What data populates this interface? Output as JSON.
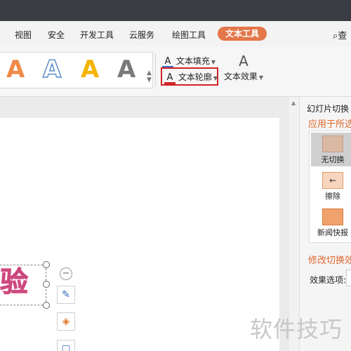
{
  "menubar": {
    "items": [
      "视图",
      "安全",
      "开发工具",
      "云服务",
      "绘图工具",
      "文本工具"
    ],
    "active_tab": "文本工具",
    "search_label": "查"
  },
  "ribbon": {
    "text_style_glyph": "A",
    "text_fill_label": "文本填充",
    "text_outline_label": "文本轮廓",
    "text_effect_label": "文本效果",
    "highlight_color": "#d32323"
  },
  "slide": {
    "visible_text": "验"
  },
  "task_pane": {
    "title": "幻灯片切换",
    "apply_label": "应用于所选",
    "transitions": [
      "无切换",
      "擦除",
      "新闻快报"
    ],
    "modify_label": "修改切换效",
    "effect_option_label": "效果选项:"
  },
  "watermark": "软件技巧",
  "colors": {
    "accent": "#e3774a",
    "pane_heading": "#e0672c",
    "titlebar": "#3b3d44"
  }
}
